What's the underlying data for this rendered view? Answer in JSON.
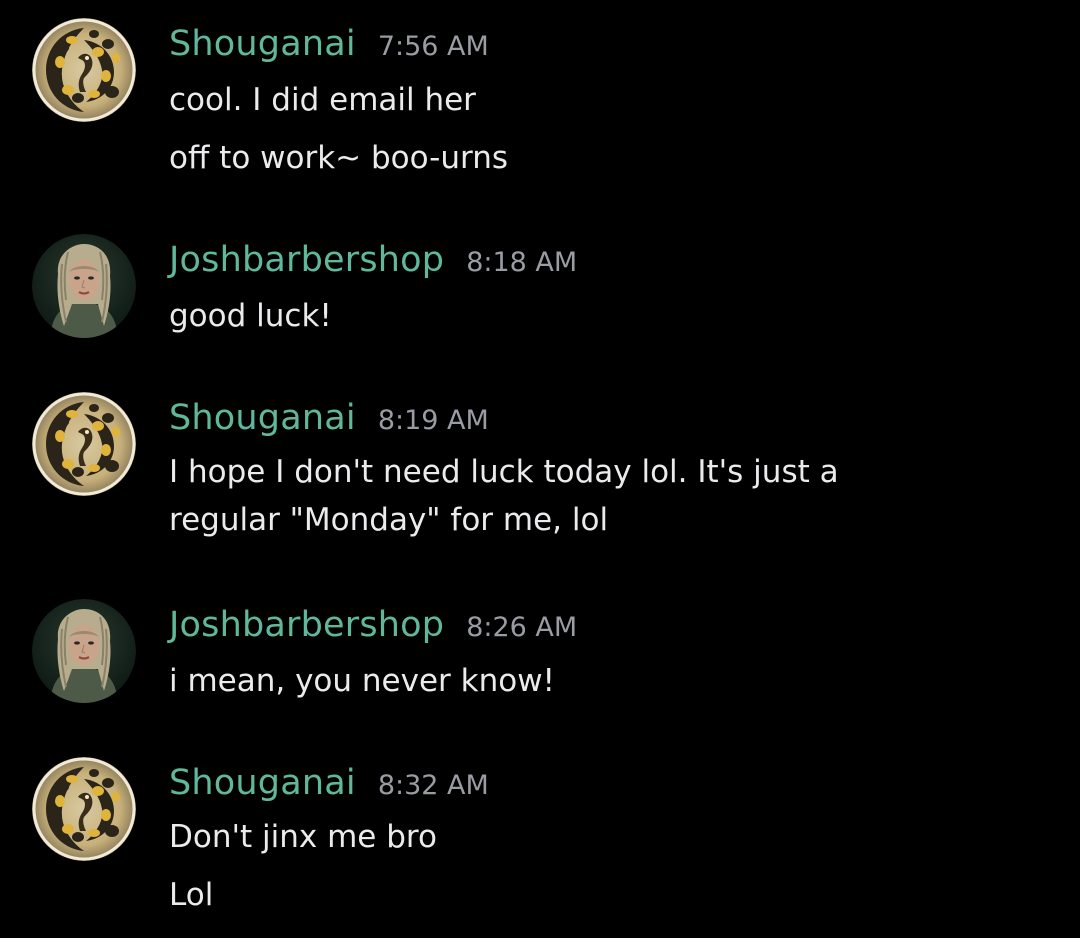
{
  "colors": {
    "background": "#000000",
    "username": "#5fb89c",
    "timestamp": "#9a9ca4",
    "message_text": "#ebebed"
  },
  "messages": [
    {
      "author": "Shouganai",
      "time": "7:56 AM",
      "avatar": "ball-python-avatar",
      "lines": [
        "cool. I did email her",
        "off to work~ boo-urns"
      ]
    },
    {
      "author": "Joshbarbershop",
      "time": "8:18 AM",
      "avatar": "character-portrait-avatar",
      "lines": [
        "good luck!"
      ]
    },
    {
      "author": "Shouganai",
      "time": "8:19 AM",
      "avatar": "ball-python-avatar",
      "lines": [
        "I hope I don't need luck today lol. It's just a regular \"Monday\" for me, lol"
      ]
    },
    {
      "author": "Joshbarbershop",
      "time": "8:26 AM",
      "avatar": "character-portrait-avatar",
      "lines": [
        "i mean, you never know!"
      ]
    },
    {
      "author": "Shouganai",
      "time": "8:32 AM",
      "avatar": "ball-python-avatar",
      "lines": [
        "Don't jinx me bro",
        "Lol"
      ]
    }
  ]
}
